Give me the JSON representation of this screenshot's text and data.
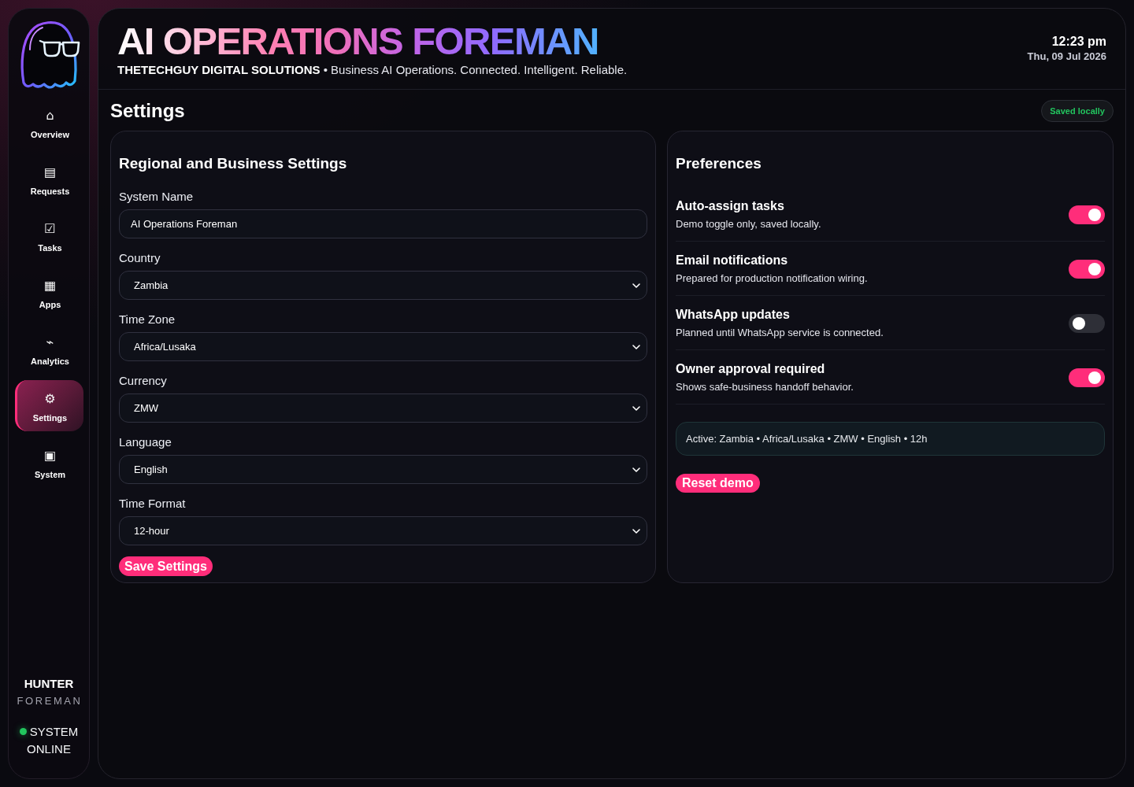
{
  "sidebar": {
    "nav": [
      {
        "icon": "⌂",
        "label": "Overview",
        "selected": false
      },
      {
        "icon": "▤",
        "label": "Requests",
        "selected": false
      },
      {
        "icon": "☑",
        "label": "Tasks",
        "selected": false
      },
      {
        "icon": "▦",
        "label": "Apps",
        "selected": false
      },
      {
        "icon": "⌁",
        "label": "Analytics",
        "selected": false
      },
      {
        "icon": "⚙",
        "label": "Settings",
        "selected": true
      },
      {
        "icon": "▣",
        "label": "System",
        "selected": false
      }
    ],
    "brand": {
      "name": "HUNTER",
      "role": "FOREMAN"
    },
    "status": {
      "label": "SYSTEM ONLINE",
      "online": true
    }
  },
  "header": {
    "title": "AI OPERATIONS FOREMAN",
    "subtitle": "**THETECHGUY DIGITAL SOLUTIONS** • Business AI Operations. Connected. Intelligent. Reliable.",
    "time": "12:23 pm",
    "date": "Thu, 09 Jul 2026"
  },
  "page": {
    "title": "Settings",
    "badge": "Saved locally"
  },
  "regional": {
    "title": "Regional and Business Settings",
    "fields": [
      {
        "kind": "text",
        "label": "System Name",
        "value": "AI Operations Foreman"
      },
      {
        "kind": "select",
        "label": "Country",
        "value": "Zambia"
      },
      {
        "kind": "select",
        "label": "Time Zone",
        "value": "Africa/Lusaka"
      },
      {
        "kind": "select",
        "label": "Currency",
        "value": "ZMW"
      },
      {
        "kind": "select",
        "label": "Language",
        "value": "English"
      },
      {
        "kind": "select",
        "label": "Time Format",
        "value": "12-hour"
      }
    ],
    "save_button": "Save Settings"
  },
  "preferences": {
    "title": "Preferences",
    "items": [
      {
        "title": "Auto-assign tasks",
        "description": "Demo toggle only, saved locally.",
        "on": true
      },
      {
        "title": "Email notifications",
        "description": "Prepared for production notification wiring.",
        "on": true
      },
      {
        "title": "WhatsApp updates",
        "description": "Planned until WhatsApp service is connected.",
        "on": false
      },
      {
        "title": "Owner approval required",
        "description": "Shows safe-business handoff behavior.",
        "on": true
      }
    ],
    "summary": "Active: Zambia • Africa/Lusaka • ZMW • English • 12h",
    "reset_button": "Reset demo"
  }
}
